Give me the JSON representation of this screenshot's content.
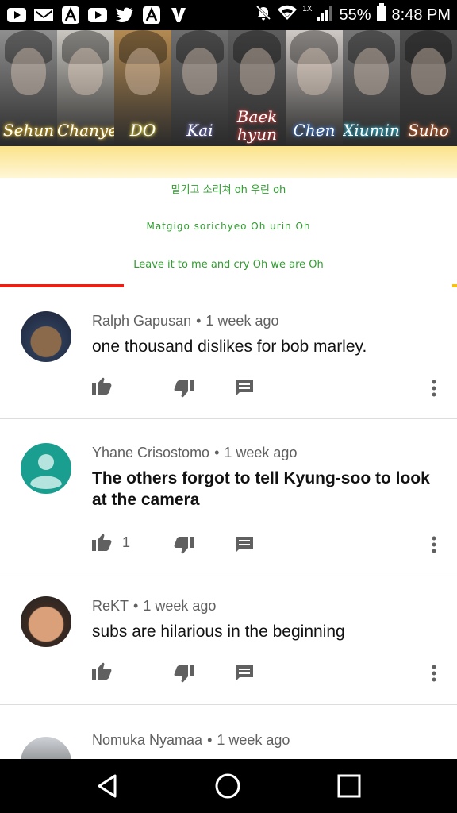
{
  "status_bar": {
    "notification_icons": [
      "youtube-icon",
      "gmail-icon",
      "amino-icon",
      "youtube-icon",
      "twitter-icon",
      "amino-icon",
      "vlive-icon"
    ],
    "signal_label": "1X",
    "battery_percent": "55%",
    "time": "8:48 PM"
  },
  "video": {
    "members": [
      {
        "name": "Sehun",
        "color": "#f0c020"
      },
      {
        "name": "Chanyeol",
        "color": "#e0b020"
      },
      {
        "name": "DO",
        "color": "#f0e040"
      },
      {
        "name": "Kai",
        "color": "#7d7dd0"
      },
      {
        "name": "Baek",
        "name2": "hyun",
        "color": "#e04040"
      },
      {
        "name": "Chen",
        "color": "#3f7fe0"
      },
      {
        "name": "Xiumin",
        "color": "#30c0e0"
      },
      {
        "name": "Suho",
        "color": "#f07030"
      }
    ],
    "lyric_korean": "맡기고 소리쳐 oh 우린 oh",
    "lyric_romanized": "Matgigo sorichyeo Oh urin Oh",
    "lyric_english": "Leave it to me and cry Oh we are Oh",
    "progress": 0.27
  },
  "comments": [
    {
      "author": "Ralph Gapusan",
      "time": "1 week ago",
      "text": "one thousand dislikes for bob marley.",
      "bold": false,
      "likes": ""
    },
    {
      "author": "Yhane Crisostomo",
      "time": "1 week ago",
      "text": "The others forgot to tell Kyung-soo to look at the camera",
      "bold": true,
      "likes": "1"
    },
    {
      "author": "ReKT",
      "time": "1 week ago",
      "text": "subs are hilarious in the beginning",
      "bold": false,
      "likes": ""
    },
    {
      "author": "Nomuka Nyamaa",
      "time": "1 week ago",
      "text": "",
      "bold": false,
      "likes": ""
    }
  ],
  "colors": {
    "accent_red": "#e62117",
    "lyric_green": "#2e9e2e",
    "default_avatar": "#1a9e8f"
  },
  "nav": [
    "back-icon",
    "home-icon",
    "recents-icon"
  ]
}
